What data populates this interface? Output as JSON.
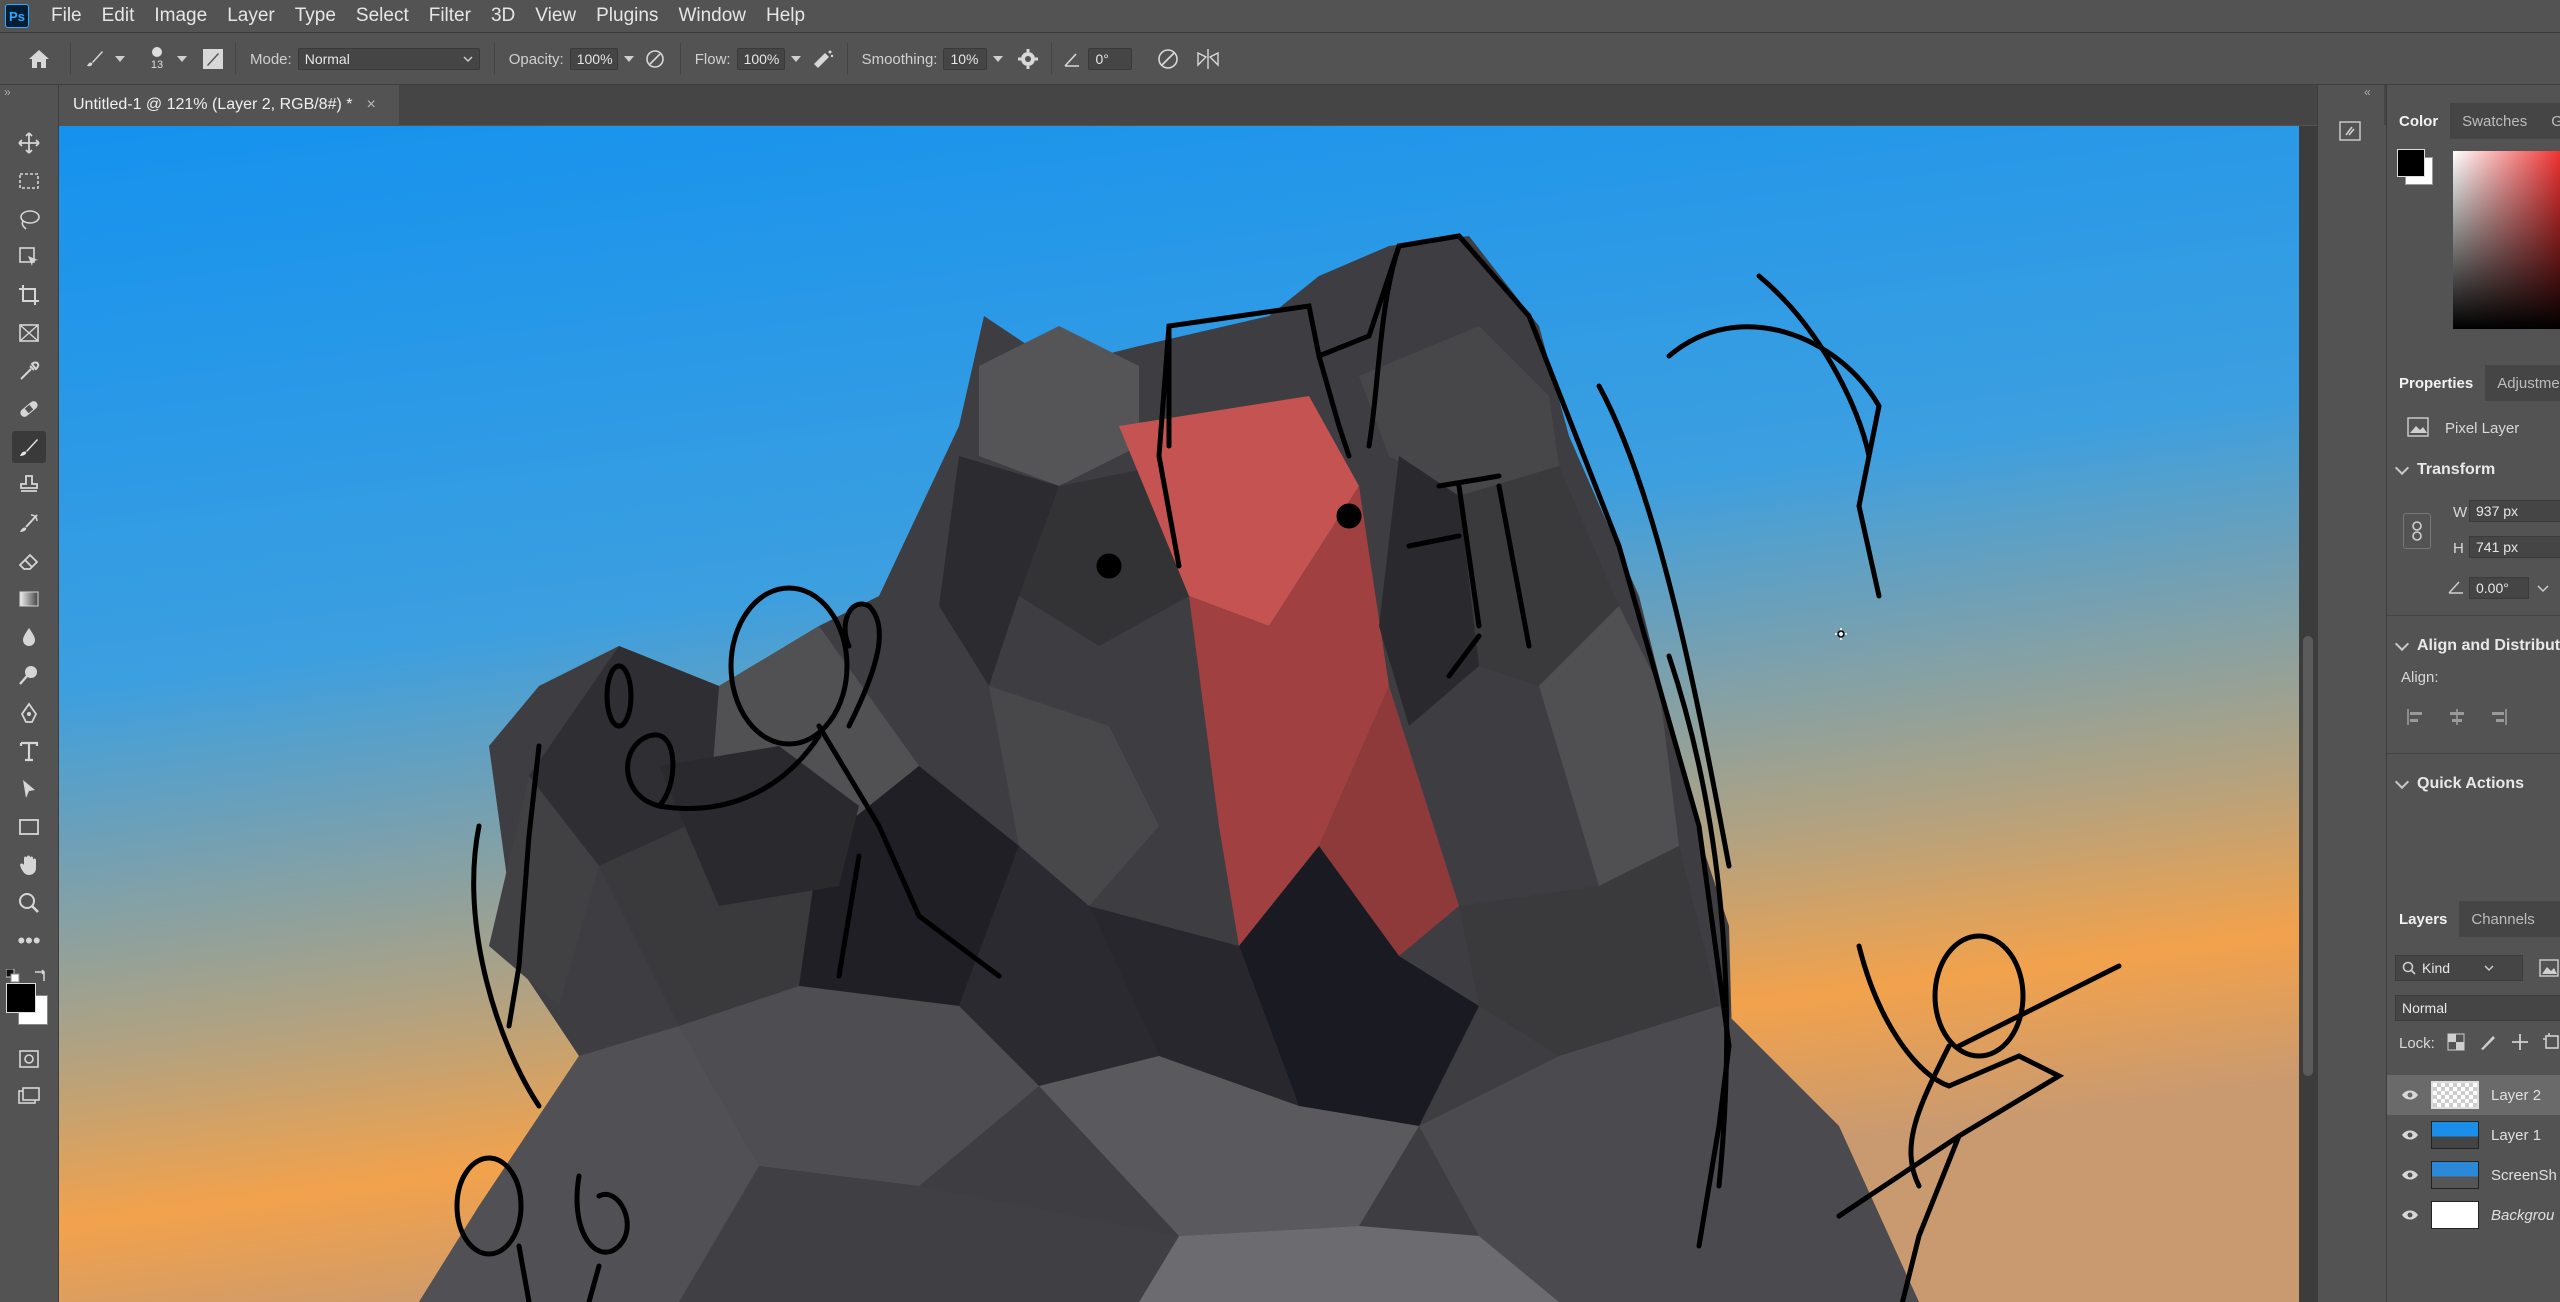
{
  "app": {
    "logo_text": "Ps"
  },
  "menubar": {
    "items": [
      "File",
      "Edit",
      "Image",
      "Layer",
      "Type",
      "Select",
      "Filter",
      "3D",
      "View",
      "Plugins",
      "Window",
      "Help"
    ]
  },
  "options": {
    "brush_size": "13",
    "mode_label": "Mode:",
    "mode_value": "Normal",
    "opacity_label": "Opacity:",
    "opacity_value": "100%",
    "flow_label": "Flow:",
    "flow_value": "100%",
    "smoothing_label": "Smoothing:",
    "smoothing_value": "10%",
    "angle_value": "0°"
  },
  "document": {
    "tab_title": "Untitled-1 @ 121% (Layer 2, RGB/8#) *",
    "close_glyph": "×"
  },
  "panels": {
    "color_tabs": [
      "Color",
      "Swatches",
      "G"
    ],
    "properties_tabs": [
      "Properties",
      "Adjustme"
    ],
    "pixel_layer_label": "Pixel Layer",
    "transform": {
      "title": "Transform",
      "w_label": "W",
      "w_value": "937 px",
      "h_label": "H",
      "h_value": "741 px",
      "angle_value": "0.00°"
    },
    "align": {
      "title": "Align and Distribut",
      "sub": "Align:"
    },
    "quick_actions": {
      "title": "Quick Actions"
    },
    "layers_tabs": [
      "Layers",
      "Channels"
    ],
    "kind_label": "Kind",
    "blend_mode": "Normal",
    "lock_label": "Lock:",
    "layers": [
      {
        "name": "Layer 2",
        "selected": true
      },
      {
        "name": "Layer 1",
        "selected": false
      },
      {
        "name": "ScreenSh",
        "selected": false
      },
      {
        "name": "Backgrou",
        "selected": false
      }
    ]
  },
  "colors": {
    "sky_top": "#1a8fea",
    "sky_bottom": "#f0a050",
    "rock": "#4a4a4d",
    "banner": "#c8504c",
    "foreground": "#000000",
    "background": "#ffffff"
  },
  "icons": [
    "home-icon",
    "brush-icon",
    "move-icon",
    "marquee-icon",
    "lasso-icon",
    "object-select-icon",
    "crop-icon",
    "frame-icon",
    "eyedropper-icon",
    "healing-icon",
    "brush-tool-icon",
    "stamp-icon",
    "history-brush-icon",
    "eraser-icon",
    "gradient-icon",
    "blur-icon",
    "dodge-icon",
    "pen-icon",
    "type-icon",
    "path-select-icon",
    "rectangle-icon",
    "hand-icon",
    "zoom-icon",
    "more-icon",
    "eye-icon"
  ]
}
